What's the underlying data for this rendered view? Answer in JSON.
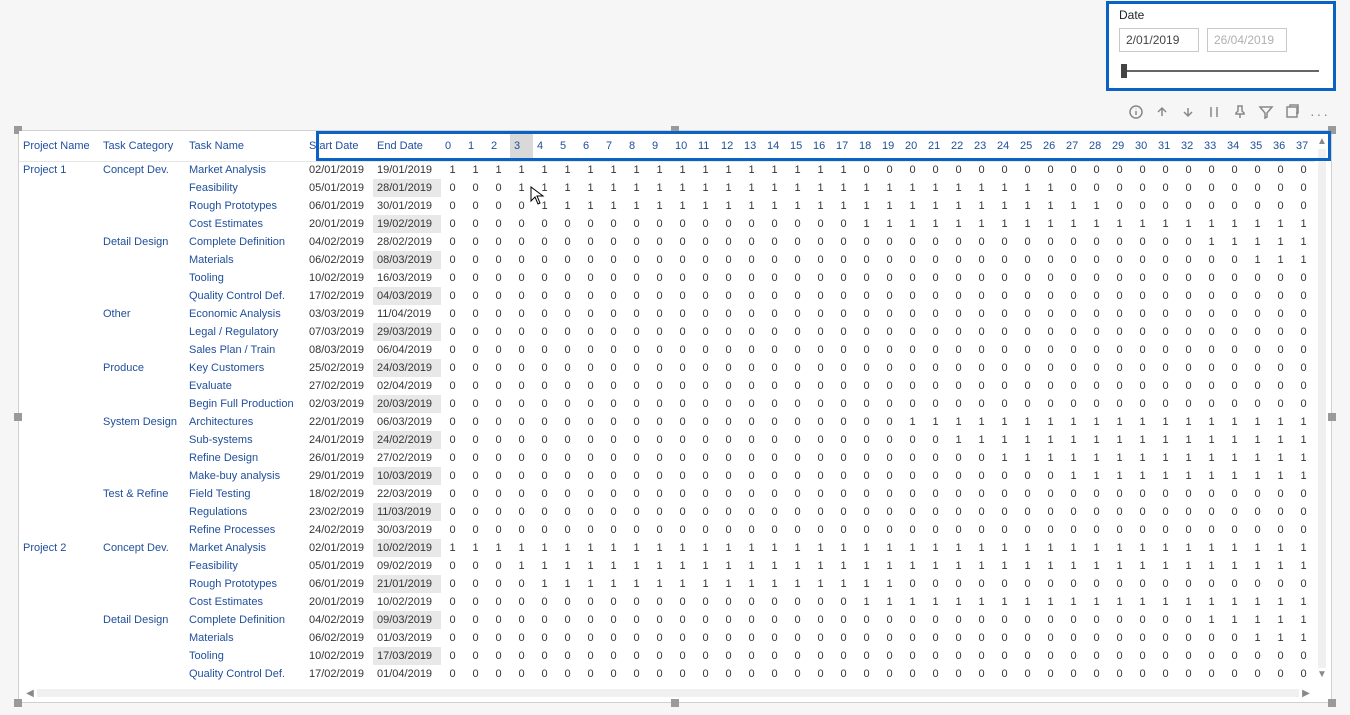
{
  "slicer": {
    "title": "Date",
    "start": "2/01/2019",
    "end_placeholder": "26/04/2019"
  },
  "toolbar_icons": [
    "info-icon",
    "up-arrow-icon",
    "down-arrow-icon",
    "bar-icon",
    "pin-icon",
    "filter-icon",
    "popout-icon",
    "more-icon"
  ],
  "columns": {
    "project": "Project Name",
    "category": "Task Category",
    "task": "Task Name",
    "start": "Start Date",
    "end": "End Date",
    "days": [
      "0",
      "1",
      "2",
      "3",
      "4",
      "5",
      "6",
      "7",
      "8",
      "9",
      "10",
      "11",
      "12",
      "13",
      "14",
      "15",
      "16",
      "17",
      "18",
      "19",
      "20",
      "21",
      "22",
      "23",
      "24",
      "25",
      "26",
      "27",
      "28",
      "29",
      "30",
      "31",
      "32",
      "33",
      "34",
      "35",
      "36",
      "37"
    ]
  },
  "rows": [
    {
      "project": "Project 1",
      "category": "Concept Dev.",
      "task": "Market Analysis",
      "start": "02/01/2019",
      "end": "19/01/2019",
      "end_hl": false,
      "days": [
        1,
        1,
        1,
        1,
        1,
        1,
        1,
        1,
        1,
        1,
        1,
        1,
        1,
        1,
        1,
        1,
        1,
        1,
        0,
        0,
        0,
        0,
        0,
        0,
        0,
        0,
        0,
        0,
        0,
        0,
        0,
        0,
        0,
        0,
        0,
        0,
        0,
        0
      ]
    },
    {
      "project": "",
      "category": "",
      "task": "Feasibility",
      "start": "05/01/2019",
      "end": "28/01/2019",
      "end_hl": true,
      "days": [
        0,
        0,
        0,
        1,
        1,
        1,
        1,
        1,
        1,
        1,
        1,
        1,
        1,
        1,
        1,
        1,
        1,
        1,
        1,
        1,
        1,
        1,
        1,
        1,
        1,
        1,
        1,
        0,
        0,
        0,
        0,
        0,
        0,
        0,
        0,
        0,
        0,
        0
      ]
    },
    {
      "project": "",
      "category": "",
      "task": "Rough Prototypes",
      "start": "06/01/2019",
      "end": "30/01/2019",
      "end_hl": false,
      "days": [
        0,
        0,
        0,
        0,
        1,
        1,
        1,
        1,
        1,
        1,
        1,
        1,
        1,
        1,
        1,
        1,
        1,
        1,
        1,
        1,
        1,
        1,
        1,
        1,
        1,
        1,
        1,
        1,
        1,
        0,
        0,
        0,
        0,
        0,
        0,
        0,
        0,
        0
      ]
    },
    {
      "project": "",
      "category": "",
      "task": "Cost Estimates",
      "start": "20/01/2019",
      "end": "19/02/2019",
      "end_hl": true,
      "days": [
        0,
        0,
        0,
        0,
        0,
        0,
        0,
        0,
        0,
        0,
        0,
        0,
        0,
        0,
        0,
        0,
        0,
        0,
        1,
        1,
        1,
        1,
        1,
        1,
        1,
        1,
        1,
        1,
        1,
        1,
        1,
        1,
        1,
        1,
        1,
        1,
        1,
        1
      ]
    },
    {
      "project": "",
      "category": "Detail Design",
      "task": "Complete Definition",
      "start": "04/02/2019",
      "end": "28/02/2019",
      "end_hl": false,
      "days": [
        0,
        0,
        0,
        0,
        0,
        0,
        0,
        0,
        0,
        0,
        0,
        0,
        0,
        0,
        0,
        0,
        0,
        0,
        0,
        0,
        0,
        0,
        0,
        0,
        0,
        0,
        0,
        0,
        0,
        0,
        0,
        0,
        0,
        1,
        1,
        1,
        1,
        1
      ]
    },
    {
      "project": "",
      "category": "",
      "task": "Materials",
      "start": "06/02/2019",
      "end": "08/03/2019",
      "end_hl": true,
      "days": [
        0,
        0,
        0,
        0,
        0,
        0,
        0,
        0,
        0,
        0,
        0,
        0,
        0,
        0,
        0,
        0,
        0,
        0,
        0,
        0,
        0,
        0,
        0,
        0,
        0,
        0,
        0,
        0,
        0,
        0,
        0,
        0,
        0,
        0,
        0,
        1,
        1,
        1
      ]
    },
    {
      "project": "",
      "category": "",
      "task": "Tooling",
      "start": "10/02/2019",
      "end": "16/03/2019",
      "end_hl": false,
      "days": [
        0,
        0,
        0,
        0,
        0,
        0,
        0,
        0,
        0,
        0,
        0,
        0,
        0,
        0,
        0,
        0,
        0,
        0,
        0,
        0,
        0,
        0,
        0,
        0,
        0,
        0,
        0,
        0,
        0,
        0,
        0,
        0,
        0,
        0,
        0,
        0,
        0,
        0
      ]
    },
    {
      "project": "",
      "category": "",
      "task": "Quality Control Def.",
      "start": "17/02/2019",
      "end": "04/03/2019",
      "end_hl": true,
      "days": [
        0,
        0,
        0,
        0,
        0,
        0,
        0,
        0,
        0,
        0,
        0,
        0,
        0,
        0,
        0,
        0,
        0,
        0,
        0,
        0,
        0,
        0,
        0,
        0,
        0,
        0,
        0,
        0,
        0,
        0,
        0,
        0,
        0,
        0,
        0,
        0,
        0,
        0
      ]
    },
    {
      "project": "",
      "category": "Other",
      "task": "Economic Analysis",
      "start": "03/03/2019",
      "end": "11/04/2019",
      "end_hl": false,
      "days": [
        0,
        0,
        0,
        0,
        0,
        0,
        0,
        0,
        0,
        0,
        0,
        0,
        0,
        0,
        0,
        0,
        0,
        0,
        0,
        0,
        0,
        0,
        0,
        0,
        0,
        0,
        0,
        0,
        0,
        0,
        0,
        0,
        0,
        0,
        0,
        0,
        0,
        0
      ]
    },
    {
      "project": "",
      "category": "",
      "task": "Legal / Regulatory",
      "start": "07/03/2019",
      "end": "29/03/2019",
      "end_hl": true,
      "days": [
        0,
        0,
        0,
        0,
        0,
        0,
        0,
        0,
        0,
        0,
        0,
        0,
        0,
        0,
        0,
        0,
        0,
        0,
        0,
        0,
        0,
        0,
        0,
        0,
        0,
        0,
        0,
        0,
        0,
        0,
        0,
        0,
        0,
        0,
        0,
        0,
        0,
        0
      ]
    },
    {
      "project": "",
      "category": "",
      "task": "Sales Plan / Train",
      "start": "08/03/2019",
      "end": "06/04/2019",
      "end_hl": false,
      "days": [
        0,
        0,
        0,
        0,
        0,
        0,
        0,
        0,
        0,
        0,
        0,
        0,
        0,
        0,
        0,
        0,
        0,
        0,
        0,
        0,
        0,
        0,
        0,
        0,
        0,
        0,
        0,
        0,
        0,
        0,
        0,
        0,
        0,
        0,
        0,
        0,
        0,
        0
      ]
    },
    {
      "project": "",
      "category": "Produce",
      "task": "Key Customers",
      "start": "25/02/2019",
      "end": "24/03/2019",
      "end_hl": true,
      "days": [
        0,
        0,
        0,
        0,
        0,
        0,
        0,
        0,
        0,
        0,
        0,
        0,
        0,
        0,
        0,
        0,
        0,
        0,
        0,
        0,
        0,
        0,
        0,
        0,
        0,
        0,
        0,
        0,
        0,
        0,
        0,
        0,
        0,
        0,
        0,
        0,
        0,
        0
      ]
    },
    {
      "project": "",
      "category": "",
      "task": "Evaluate",
      "start": "27/02/2019",
      "end": "02/04/2019",
      "end_hl": false,
      "days": [
        0,
        0,
        0,
        0,
        0,
        0,
        0,
        0,
        0,
        0,
        0,
        0,
        0,
        0,
        0,
        0,
        0,
        0,
        0,
        0,
        0,
        0,
        0,
        0,
        0,
        0,
        0,
        0,
        0,
        0,
        0,
        0,
        0,
        0,
        0,
        0,
        0,
        0
      ]
    },
    {
      "project": "",
      "category": "",
      "task": "Begin Full Production",
      "start": "02/03/2019",
      "end": "20/03/2019",
      "end_hl": true,
      "days": [
        0,
        0,
        0,
        0,
        0,
        0,
        0,
        0,
        0,
        0,
        0,
        0,
        0,
        0,
        0,
        0,
        0,
        0,
        0,
        0,
        0,
        0,
        0,
        0,
        0,
        0,
        0,
        0,
        0,
        0,
        0,
        0,
        0,
        0,
        0,
        0,
        0,
        0
      ]
    },
    {
      "project": "",
      "category": "System Design",
      "task": "Architectures",
      "start": "22/01/2019",
      "end": "06/03/2019",
      "end_hl": false,
      "days": [
        0,
        0,
        0,
        0,
        0,
        0,
        0,
        0,
        0,
        0,
        0,
        0,
        0,
        0,
        0,
        0,
        0,
        0,
        0,
        0,
        1,
        1,
        1,
        1,
        1,
        1,
        1,
        1,
        1,
        1,
        1,
        1,
        1,
        1,
        1,
        1,
        1,
        1
      ]
    },
    {
      "project": "",
      "category": "",
      "task": "Sub-systems",
      "start": "24/01/2019",
      "end": "24/02/2019",
      "end_hl": true,
      "days": [
        0,
        0,
        0,
        0,
        0,
        0,
        0,
        0,
        0,
        0,
        0,
        0,
        0,
        0,
        0,
        0,
        0,
        0,
        0,
        0,
        0,
        0,
        1,
        1,
        1,
        1,
        1,
        1,
        1,
        1,
        1,
        1,
        1,
        1,
        1,
        1,
        1,
        1
      ]
    },
    {
      "project": "",
      "category": "",
      "task": "Refine Design",
      "start": "26/01/2019",
      "end": "27/02/2019",
      "end_hl": false,
      "days": [
        0,
        0,
        0,
        0,
        0,
        0,
        0,
        0,
        0,
        0,
        0,
        0,
        0,
        0,
        0,
        0,
        0,
        0,
        0,
        0,
        0,
        0,
        0,
        0,
        1,
        1,
        1,
        1,
        1,
        1,
        1,
        1,
        1,
        1,
        1,
        1,
        1,
        1
      ]
    },
    {
      "project": "",
      "category": "",
      "task": "Make-buy analysis",
      "start": "29/01/2019",
      "end": "10/03/2019",
      "end_hl": true,
      "days": [
        0,
        0,
        0,
        0,
        0,
        0,
        0,
        0,
        0,
        0,
        0,
        0,
        0,
        0,
        0,
        0,
        0,
        0,
        0,
        0,
        0,
        0,
        0,
        0,
        0,
        0,
        0,
        1,
        1,
        1,
        1,
        1,
        1,
        1,
        1,
        1,
        1,
        1
      ]
    },
    {
      "project": "",
      "category": "Test & Refine",
      "task": "Field Testing",
      "start": "18/02/2019",
      "end": "22/03/2019",
      "end_hl": false,
      "days": [
        0,
        0,
        0,
        0,
        0,
        0,
        0,
        0,
        0,
        0,
        0,
        0,
        0,
        0,
        0,
        0,
        0,
        0,
        0,
        0,
        0,
        0,
        0,
        0,
        0,
        0,
        0,
        0,
        0,
        0,
        0,
        0,
        0,
        0,
        0,
        0,
        0,
        0
      ]
    },
    {
      "project": "",
      "category": "",
      "task": "Regulations",
      "start": "23/02/2019",
      "end": "11/03/2019",
      "end_hl": true,
      "days": [
        0,
        0,
        0,
        0,
        0,
        0,
        0,
        0,
        0,
        0,
        0,
        0,
        0,
        0,
        0,
        0,
        0,
        0,
        0,
        0,
        0,
        0,
        0,
        0,
        0,
        0,
        0,
        0,
        0,
        0,
        0,
        0,
        0,
        0,
        0,
        0,
        0,
        0
      ]
    },
    {
      "project": "",
      "category": "",
      "task": "Refine Processes",
      "start": "24/02/2019",
      "end": "30/03/2019",
      "end_hl": false,
      "days": [
        0,
        0,
        0,
        0,
        0,
        0,
        0,
        0,
        0,
        0,
        0,
        0,
        0,
        0,
        0,
        0,
        0,
        0,
        0,
        0,
        0,
        0,
        0,
        0,
        0,
        0,
        0,
        0,
        0,
        0,
        0,
        0,
        0,
        0,
        0,
        0,
        0,
        0
      ]
    },
    {
      "project": "Project 2",
      "category": "Concept Dev.",
      "task": "Market Analysis",
      "start": "02/01/2019",
      "end": "10/02/2019",
      "end_hl": true,
      "days": [
        1,
        1,
        1,
        1,
        1,
        1,
        1,
        1,
        1,
        1,
        1,
        1,
        1,
        1,
        1,
        1,
        1,
        1,
        1,
        1,
        1,
        1,
        1,
        1,
        1,
        1,
        1,
        1,
        1,
        1,
        1,
        1,
        1,
        1,
        1,
        1,
        1,
        1
      ]
    },
    {
      "project": "",
      "category": "",
      "task": "Feasibility",
      "start": "05/01/2019",
      "end": "09/02/2019",
      "end_hl": false,
      "days": [
        0,
        0,
        0,
        1,
        1,
        1,
        1,
        1,
        1,
        1,
        1,
        1,
        1,
        1,
        1,
        1,
        1,
        1,
        1,
        1,
        1,
        1,
        1,
        1,
        1,
        1,
        1,
        1,
        1,
        1,
        1,
        1,
        1,
        1,
        1,
        1,
        1,
        1
      ]
    },
    {
      "project": "",
      "category": "",
      "task": "Rough Prototypes",
      "start": "06/01/2019",
      "end": "21/01/2019",
      "end_hl": true,
      "days": [
        0,
        0,
        0,
        0,
        1,
        1,
        1,
        1,
        1,
        1,
        1,
        1,
        1,
        1,
        1,
        1,
        1,
        1,
        1,
        1,
        0,
        0,
        0,
        0,
        0,
        0,
        0,
        0,
        0,
        0,
        0,
        0,
        0,
        0,
        0,
        0,
        0,
        0
      ]
    },
    {
      "project": "",
      "category": "",
      "task": "Cost Estimates",
      "start": "20/01/2019",
      "end": "10/02/2019",
      "end_hl": false,
      "days": [
        0,
        0,
        0,
        0,
        0,
        0,
        0,
        0,
        0,
        0,
        0,
        0,
        0,
        0,
        0,
        0,
        0,
        0,
        1,
        1,
        1,
        1,
        1,
        1,
        1,
        1,
        1,
        1,
        1,
        1,
        1,
        1,
        1,
        1,
        1,
        1,
        1,
        1
      ]
    },
    {
      "project": "",
      "category": "Detail Design",
      "task": "Complete Definition",
      "start": "04/02/2019",
      "end": "09/03/2019",
      "end_hl": true,
      "days": [
        0,
        0,
        0,
        0,
        0,
        0,
        0,
        0,
        0,
        0,
        0,
        0,
        0,
        0,
        0,
        0,
        0,
        0,
        0,
        0,
        0,
        0,
        0,
        0,
        0,
        0,
        0,
        0,
        0,
        0,
        0,
        0,
        0,
        1,
        1,
        1,
        1,
        1
      ]
    },
    {
      "project": "",
      "category": "",
      "task": "Materials",
      "start": "06/02/2019",
      "end": "01/03/2019",
      "end_hl": false,
      "days": [
        0,
        0,
        0,
        0,
        0,
        0,
        0,
        0,
        0,
        0,
        0,
        0,
        0,
        0,
        0,
        0,
        0,
        0,
        0,
        0,
        0,
        0,
        0,
        0,
        0,
        0,
        0,
        0,
        0,
        0,
        0,
        0,
        0,
        0,
        0,
        1,
        1,
        1
      ]
    },
    {
      "project": "",
      "category": "",
      "task": "Tooling",
      "start": "10/02/2019",
      "end": "17/03/2019",
      "end_hl": true,
      "days": [
        0,
        0,
        0,
        0,
        0,
        0,
        0,
        0,
        0,
        0,
        0,
        0,
        0,
        0,
        0,
        0,
        0,
        0,
        0,
        0,
        0,
        0,
        0,
        0,
        0,
        0,
        0,
        0,
        0,
        0,
        0,
        0,
        0,
        0,
        0,
        0,
        0,
        0
      ]
    },
    {
      "project": "",
      "category": "",
      "task": "Quality Control Def.",
      "start": "17/02/2019",
      "end": "01/04/2019",
      "end_hl": false,
      "days": [
        0,
        0,
        0,
        0,
        0,
        0,
        0,
        0,
        0,
        0,
        0,
        0,
        0,
        0,
        0,
        0,
        0,
        0,
        0,
        0,
        0,
        0,
        0,
        0,
        0,
        0,
        0,
        0,
        0,
        0,
        0,
        0,
        0,
        0,
        0,
        0,
        0,
        0
      ]
    }
  ]
}
